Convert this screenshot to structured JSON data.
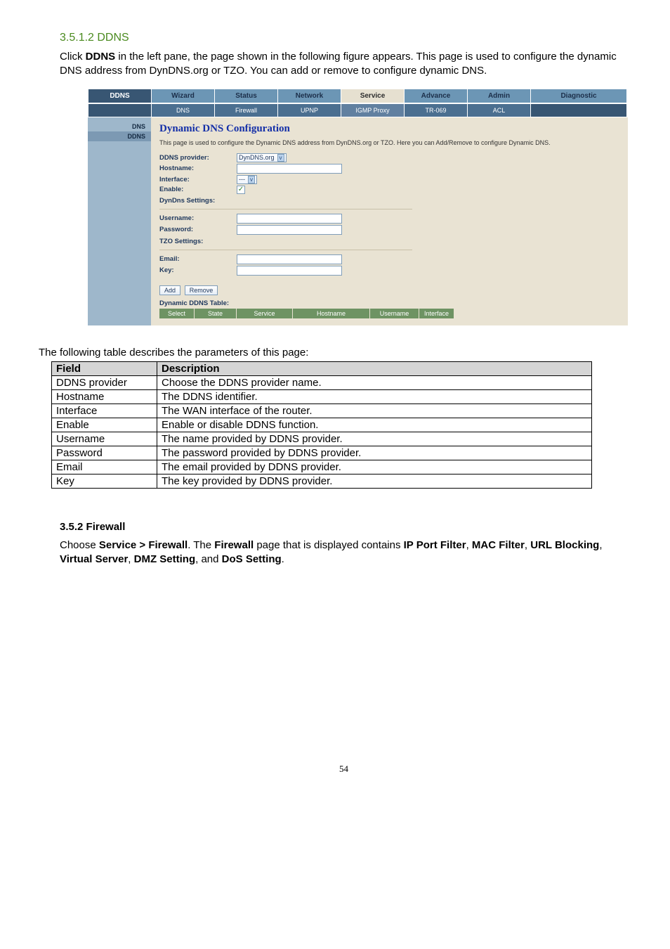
{
  "section": {
    "heading_ddns": "3.5.1.2 DDNS",
    "intro_ddns": "Click DDNS in the left pane, the page shown in the following figure appears. This page is used to configure the dynamic DNS address from DynDNS.org or TZO. You can add or remove to configure dynamic DNS.",
    "bold_ddns": "DDNS",
    "table_caption": "The following table describes the parameters of this page:",
    "heading_firewall": "3.5.2 Firewall",
    "fw_text_pre": "Choose ",
    "fw_b1": "Service > Firewall",
    "fw_text_2": ". The ",
    "fw_b2": "Firewall",
    "fw_text_3": " page that is displayed contains ",
    "fw_b3": "IP Port Filter",
    "fw_text_4": ", ",
    "fw_b4": "MAC Filter",
    "fw_text_5": ", ",
    "fw_b5": "URL Blocking",
    "fw_text_6": ", ",
    "fw_b6": "Virtual Server",
    "fw_text_7": ", ",
    "fw_b7": "DMZ Setting",
    "fw_text_8": ", and ",
    "fw_b8": "DoS Setting",
    "fw_text_9": ".",
    "pageno": "54"
  },
  "shot": {
    "topbar": {
      "ddns": "DDNS",
      "wizard": "Wizard",
      "status": "Status",
      "network": "Network",
      "service": "Service",
      "advance": "Advance",
      "admin": "Admin",
      "diagnostic": "Diagnostic"
    },
    "subbar": {
      "dns": "DNS",
      "firewall": "Firewall",
      "upnp": "UPNP",
      "igmp": "IGMP Proxy",
      "tr069": "TR-069",
      "acl": "ACL"
    },
    "side": {
      "dns": "DNS",
      "ddns": "DDNS"
    },
    "cfg": {
      "title": "Dynamic DNS Configuration",
      "desc": "This page is used to configure the Dynamic DNS address from DynDNS.org or TZO. Here you can Add/Remove to configure Dynamic DNS.",
      "provider_label": "DDNS provider:",
      "provider_value": "DynDNS.org",
      "hostname_label": "Hostname:",
      "interface_label": "Interface:",
      "interface_value": "---",
      "enable_label": "Enable:",
      "dyndns_settings": "DynDns Settings:",
      "username_label": "Username:",
      "password_label": "Password:",
      "tzo_settings": "TZO Settings:",
      "email_label": "Email:",
      "key_label": "Key:",
      "add_btn": "Add",
      "remove_btn": "Remove",
      "tbl_title": "Dynamic DDNS Table:",
      "th_select": "Select",
      "th_state": "State",
      "th_service": "Service",
      "th_hostname": "Hostname",
      "th_username": "Username",
      "th_interface": "Interface"
    }
  },
  "param_table": {
    "h_field": "Field",
    "h_desc": "Description",
    "rows": [
      {
        "f": "DDNS provider",
        "d": "Choose the DDNS provider name."
      },
      {
        "f": "Hostname",
        "d": "The DDNS identifier."
      },
      {
        "f": "Interface",
        "d": "The WAN interface of the router."
      },
      {
        "f": "Enable",
        "d": "Enable or disable DDNS function."
      },
      {
        "f": "Username",
        "d": "The name provided by DDNS provider."
      },
      {
        "f": "Password",
        "d": "The password provided by DDNS provider."
      },
      {
        "f": "Email",
        "d": "The email provided by DDNS provider."
      },
      {
        "f": "Key",
        "d": "The key provided by DDNS provider."
      }
    ]
  }
}
